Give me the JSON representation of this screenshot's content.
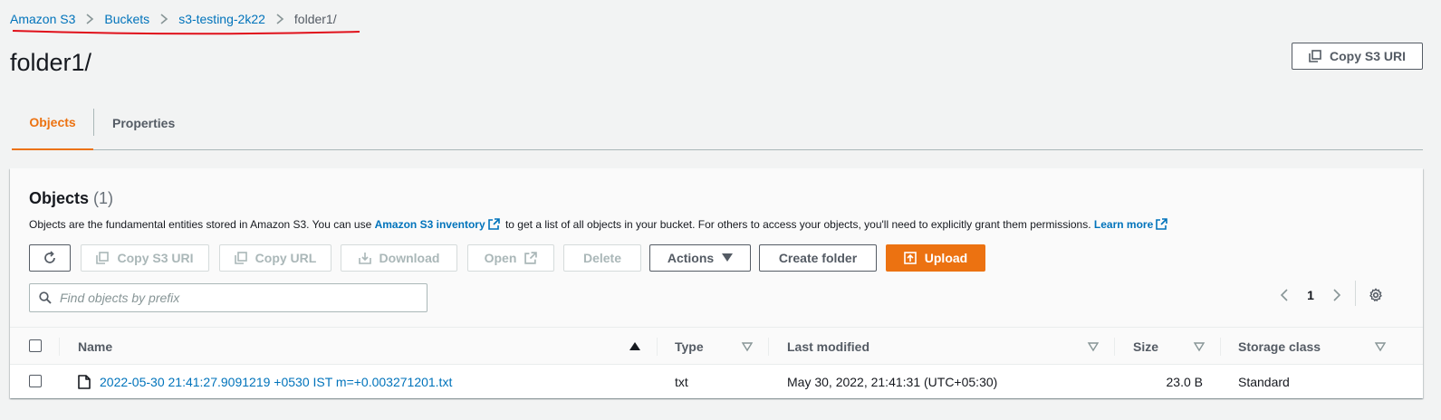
{
  "breadcrumb": {
    "items": [
      "Amazon S3",
      "Buckets",
      "s3-testing-2k22"
    ],
    "current": "folder1/"
  },
  "page": {
    "title": "folder1/",
    "copy_uri_label": "Copy S3 URI"
  },
  "tabs": [
    {
      "label": "Objects",
      "active": true
    },
    {
      "label": "Properties",
      "active": false
    }
  ],
  "objects_panel": {
    "title": "Objects",
    "count": "(1)",
    "description_prefix": "Objects are the fundamental entities stored in Amazon S3. You can use",
    "inventory_link": "Amazon S3 inventory",
    "description_middle": "to get a list of all objects in your bucket. For others to access your objects, you'll need to explicitly grant them permissions.",
    "learn_more": "Learn more"
  },
  "toolbar": {
    "copy_s3_uri": "Copy S3 URI",
    "copy_url": "Copy URL",
    "download": "Download",
    "open": "Open",
    "delete": "Delete",
    "actions": "Actions",
    "create_folder": "Create folder",
    "upload": "Upload"
  },
  "search": {
    "placeholder": "Find objects by prefix",
    "value": ""
  },
  "pagination": {
    "current_page": "1"
  },
  "table": {
    "columns": [
      "Name",
      "Type",
      "Last modified",
      "Size",
      "Storage class"
    ],
    "rows": [
      {
        "name": "2022-05-30 21:41:27.9091219 +0530 IST m=+0.003271201.txt",
        "type": "txt",
        "last_modified": "May 30, 2022, 21:41:31 (UTC+05:30)",
        "size": "23.0 B",
        "storage_class": "Standard"
      }
    ]
  },
  "colors": {
    "link": "#0073bb",
    "accent": "#ec7211",
    "annotation_red": "#e0101a"
  }
}
